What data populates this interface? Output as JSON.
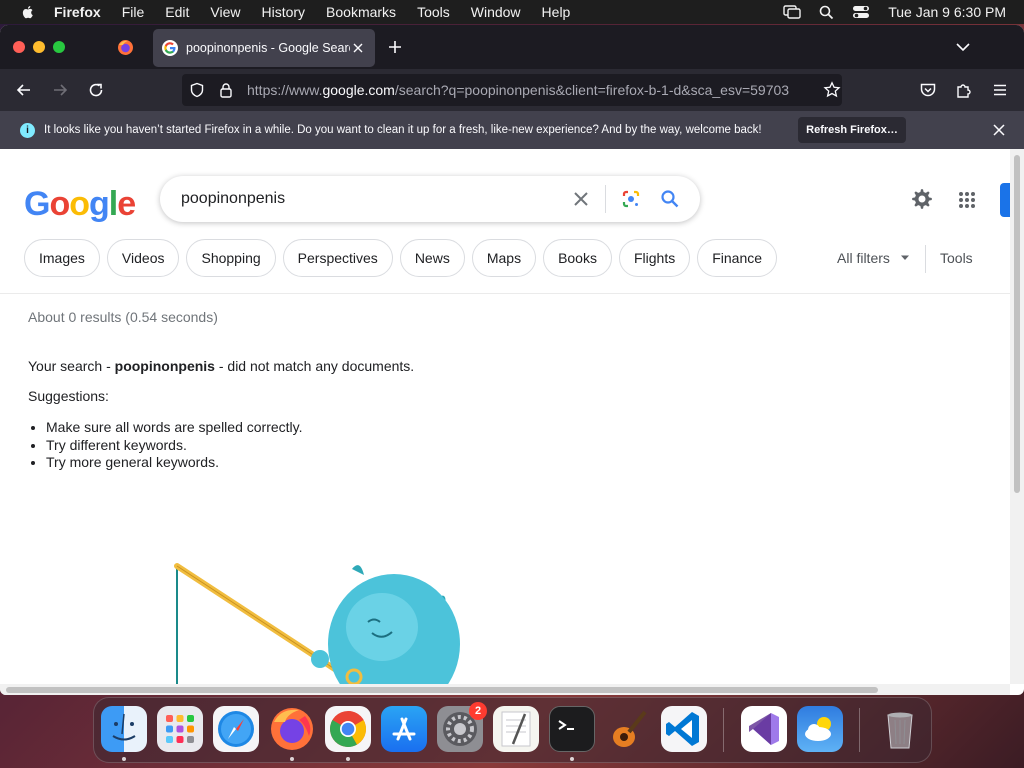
{
  "menubar": {
    "app_name": "Firefox",
    "items": [
      "File",
      "Edit",
      "View",
      "History",
      "Bookmarks",
      "Tools",
      "Window",
      "Help"
    ],
    "clock": "Tue Jan 9  6:30 PM"
  },
  "browser": {
    "tab_title": "poopinonpenis - Google Search",
    "url_prefix": "https://www.",
    "url_host": "google.com",
    "url_rest": "/search?q=poopinonpenis&client=firefox-b-1-d&sca_esv=59703"
  },
  "notice": {
    "message": "It looks like you haven’t started Firefox in a while. Do you want to clean it up for a fresh, like-new experience? And by the way, welcome back!",
    "button": "Refresh Firefox…"
  },
  "google": {
    "logo": [
      "G",
      "o",
      "o",
      "g",
      "l",
      "e"
    ],
    "query": "poopinonpenis",
    "chips": [
      "Images",
      "Videos",
      "Shopping",
      "Perspectives",
      "News",
      "Maps",
      "Books",
      "Flights",
      "Finance"
    ],
    "all_filters": "All filters",
    "tools": "Tools",
    "stats": "About 0 results (0.54 seconds)",
    "no_match_prefix": "Your search - ",
    "no_match_term": "poopinonpenis",
    "no_match_suffix": " - did not match any documents.",
    "suggestions_label": "Suggestions:",
    "suggestions": [
      "Make sure all words are spelled correctly.",
      "Try different keywords.",
      "Try more general keywords."
    ]
  },
  "dock": {
    "settings_badge": "2"
  },
  "colors": {
    "google_blue": "#4285f4",
    "google_red": "#ea4335",
    "google_yellow": "#fbbc05",
    "google_green": "#34a853",
    "firefox_chrome": "#2b2a33"
  }
}
